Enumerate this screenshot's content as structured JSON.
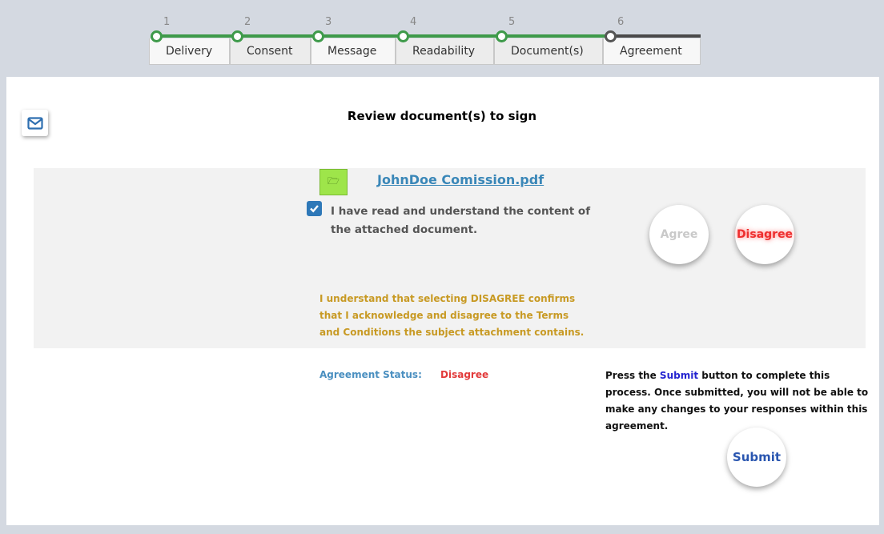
{
  "stepper": {
    "steps": [
      {
        "number": "1",
        "label": "Delivery"
      },
      {
        "number": "2",
        "label": "Consent"
      },
      {
        "number": "3",
        "label": "Message"
      },
      {
        "number": "4",
        "label": "Readability"
      },
      {
        "number": "5",
        "label": "Document(s)"
      },
      {
        "number": "6",
        "label": "Agreement"
      }
    ]
  },
  "page": {
    "title": "Review document(s) to sign"
  },
  "document": {
    "filename": "JohnDoe Comission.pdf",
    "checkbox_checked": true,
    "read_confirmation": "I have read and understand the content of the attached document.",
    "disagree_notice": "I understand that selecting DISAGREE confirms that I acknowledge and disagree to the Terms and Conditions the subject attachment contains.",
    "agree_label": "Agree",
    "disagree_label": "Disagree"
  },
  "status": {
    "label": "Agreement Status:",
    "value": "Disagree"
  },
  "submit": {
    "info_prefix": "Press the ",
    "info_highlight": "Submit",
    "info_suffix": " button to complete this process. Once submitted, you will not be able to make any changes to your responses within this agreement.",
    "button_label": "Submit"
  },
  "icons": {
    "mail": "envelope-icon",
    "folder": "folder-open-icon",
    "check": "checkmark-icon"
  },
  "colors": {
    "step_complete": "#3e9a4a",
    "step_current": "#4a4a4a",
    "link": "#3a87b8",
    "warning": "#c89a24",
    "disagree": "#ee2e2e",
    "status_label": "#4a8fc0",
    "submit_highlight": "#2424d0"
  }
}
